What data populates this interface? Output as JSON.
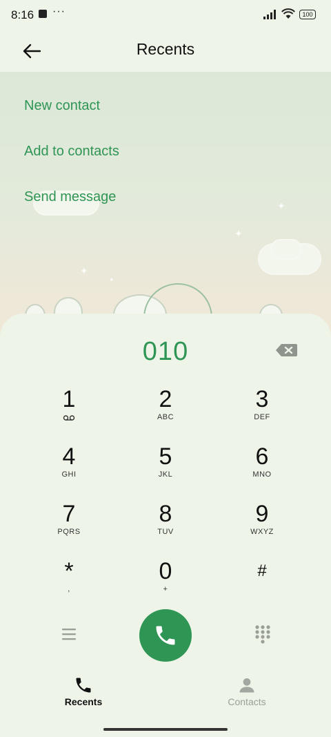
{
  "status": {
    "time": "8:16",
    "dots": "···",
    "battery": "100"
  },
  "header": {
    "title": "Recents"
  },
  "menu": [
    {
      "label": "New contact"
    },
    {
      "label": "Add to contacts"
    },
    {
      "label": "Send message"
    }
  ],
  "dialer": {
    "number": "010",
    "keys": [
      {
        "digit": "1",
        "letters": "ᴼᴼ"
      },
      {
        "digit": "2",
        "letters": "ABC"
      },
      {
        "digit": "3",
        "letters": "DEF"
      },
      {
        "digit": "4",
        "letters": "GHI"
      },
      {
        "digit": "5",
        "letters": "JKL"
      },
      {
        "digit": "6",
        "letters": "MNO"
      },
      {
        "digit": "7",
        "letters": "PQRS"
      },
      {
        "digit": "8",
        "letters": "TUV"
      },
      {
        "digit": "9",
        "letters": "WXYZ"
      },
      {
        "digit": "*",
        "letters": ","
      },
      {
        "digit": "0",
        "letters": "+"
      },
      {
        "digit": "#",
        "letters": ""
      }
    ]
  },
  "tabs": [
    {
      "label": "Recents",
      "active": true
    },
    {
      "label": "Contacts",
      "active": false
    }
  ],
  "colors": {
    "accent": "#2e9554",
    "background": "#eef4e8"
  }
}
